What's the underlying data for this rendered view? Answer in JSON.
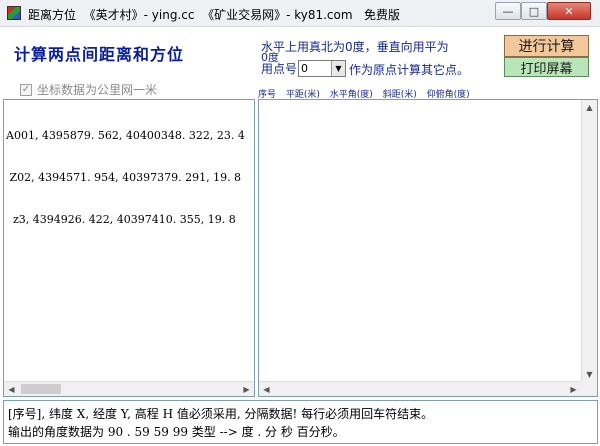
{
  "window": {
    "title": "距离方位  《英才村》- ying.cc  《矿业交易网》- ky81.com   免费版",
    "min_glyph": "—",
    "max_glyph": "□",
    "close_glyph": "✕"
  },
  "header": {
    "heading": "计算两点间距离和方位",
    "info_line1": "水平上用真北为0度，垂直向用平为",
    "info_line2": "0度",
    "info_prefix": "用点号",
    "selected_point": "0",
    "info_suffix": "作为原点计算其它点。",
    "calc_button": "进行计算",
    "print_button": "打印屏幕",
    "checkbox_label": "坐标数据为公里网一米",
    "checkbox_checked": true
  },
  "columns": [
    "序号",
    "平距(米)",
    "水平角(度)",
    "斜距(米)",
    "仰俯角(度)"
  ],
  "input_lines": [
    "A001, 4395879. 562, 40400348. 322, 23. 4",
    " Z02, 4394571. 954, 40397379. 291, 19. 8",
    "  z3, 4394926. 422, 40397410. 355, 19. 8"
  ],
  "help": {
    "line1": "[序号], 纬度 X, 经度 Y, 高程 H 值必须采用, 分隔数据! 每行必须用回车符结束。",
    "line2": "输出的角度数据为 90 . 59 59 99 类型 --> 度 . 分 秒 百分秒。"
  },
  "icons": {
    "app": "app-icon",
    "combo_arrow": "▼",
    "scroll_left": "◀",
    "scroll_right": "▶",
    "scroll_up": "▲",
    "scroll_down": "▼",
    "check": "✓"
  }
}
